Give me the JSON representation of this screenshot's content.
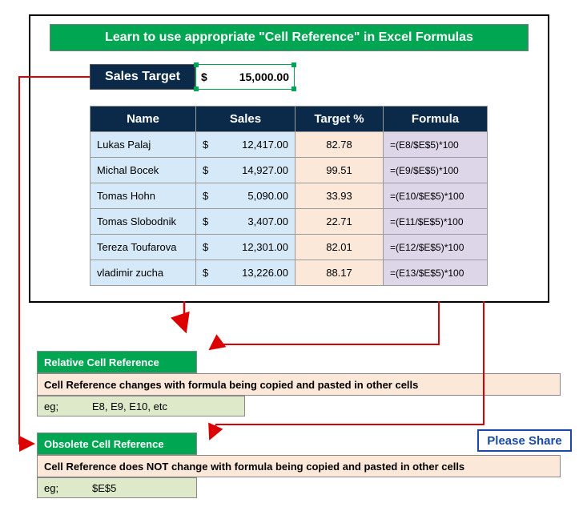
{
  "title": "Learn to use appropriate \"Cell Reference\" in Excel Formulas",
  "salesTarget": {
    "label": "Sales Target",
    "currency": "$",
    "value": "15,000.00"
  },
  "headers": {
    "name": "Name",
    "sales": "Sales",
    "target": "Target %",
    "formula": "Formula"
  },
  "rows": [
    {
      "name": "Lukas Palaj",
      "cur": "$",
      "sales": "12,417.00",
      "target": "82.78",
      "formula": "=(E8/$E$5)*100"
    },
    {
      "name": "Michal Bocek",
      "cur": "$",
      "sales": "14,927.00",
      "target": "99.51",
      "formula": "=(E9/$E$5)*100"
    },
    {
      "name": "Tomas Hohn",
      "cur": "$",
      "sales": "5,090.00",
      "target": "33.93",
      "formula": "=(E10/$E$5)*100"
    },
    {
      "name": "Tomas Slobodnik",
      "cur": "$",
      "sales": "3,407.00",
      "target": "22.71",
      "formula": "=(E11/$E$5)*100"
    },
    {
      "name": "Tereza Toufarova",
      "cur": "$",
      "sales": "12,301.00",
      "target": "82.01",
      "formula": "=(E12/$E$5)*100"
    },
    {
      "name": "vladimir zucha",
      "cur": "$",
      "sales": "13,226.00",
      "target": "88.17",
      "formula": "=(E13/$E$5)*100"
    }
  ],
  "relative": {
    "header": "Relative Cell Reference",
    "desc": "Cell Reference changes with formula being copied and pasted in other cells",
    "egLabel": "eg;",
    "egValue": "E8, E9, E10, etc"
  },
  "obsolete": {
    "header": "Obsolete Cell Reference",
    "desc": "Cell Reference does NOT change with formula being copied and pasted in other cells",
    "egLabel": "eg;",
    "egValue": "$E$5"
  },
  "share": "Please Share"
}
